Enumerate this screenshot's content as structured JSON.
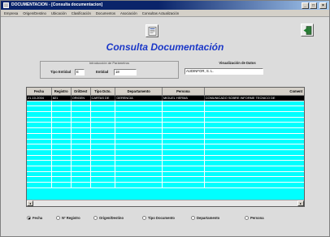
{
  "window": {
    "title": "DOCUMENTACION - [Consulta documentacion]",
    "controls": [
      "_",
      "□",
      "×"
    ]
  },
  "menu": [
    "Empresa",
    "Origen/Destino",
    "Ubicación",
    "Clasificación",
    "Documentos",
    "Asociación",
    "Consultas Actualización"
  ],
  "header": {
    "title": "Consulta Documentación",
    "doc_icon": "document-icon",
    "exit_icon": "exit-door-icon"
  },
  "params": {
    "caption": "Introducción de Parámetros",
    "tipo_entidad_label": "Tipo Entidad",
    "tipo_entidad_value": "E",
    "entidad_label": "Entidad",
    "entidad_value": "18"
  },
  "view": {
    "caption": "Visualización de Datos",
    "entity_name": "AUDINFOR, S. L."
  },
  "table": {
    "columns": [
      "Fecha",
      "Registro",
      "Ori/Dest",
      "Tipo Dcto.",
      "Departamento",
      "Persona",
      "Coment"
    ],
    "rows": [
      [
        "21-10-2004",
        "821",
        "ORIGEN",
        "CARTAS DE",
        "GERENCIA",
        "MIGUEL HERMA",
        "COMUNICADO SOBRE INFORME TECNICO DE"
      ]
    ],
    "empty_rows": 16
  },
  "sort": {
    "options": [
      "Fecha",
      "Nº Registro",
      "Origen/Destino",
      "Tipo Documento",
      "Departamento",
      "Persona"
    ],
    "selected": "Fecha"
  },
  "colors": {
    "grid_bg": "#00ffff",
    "heading": "#1a37c8",
    "titlebar": "#0a246a"
  }
}
